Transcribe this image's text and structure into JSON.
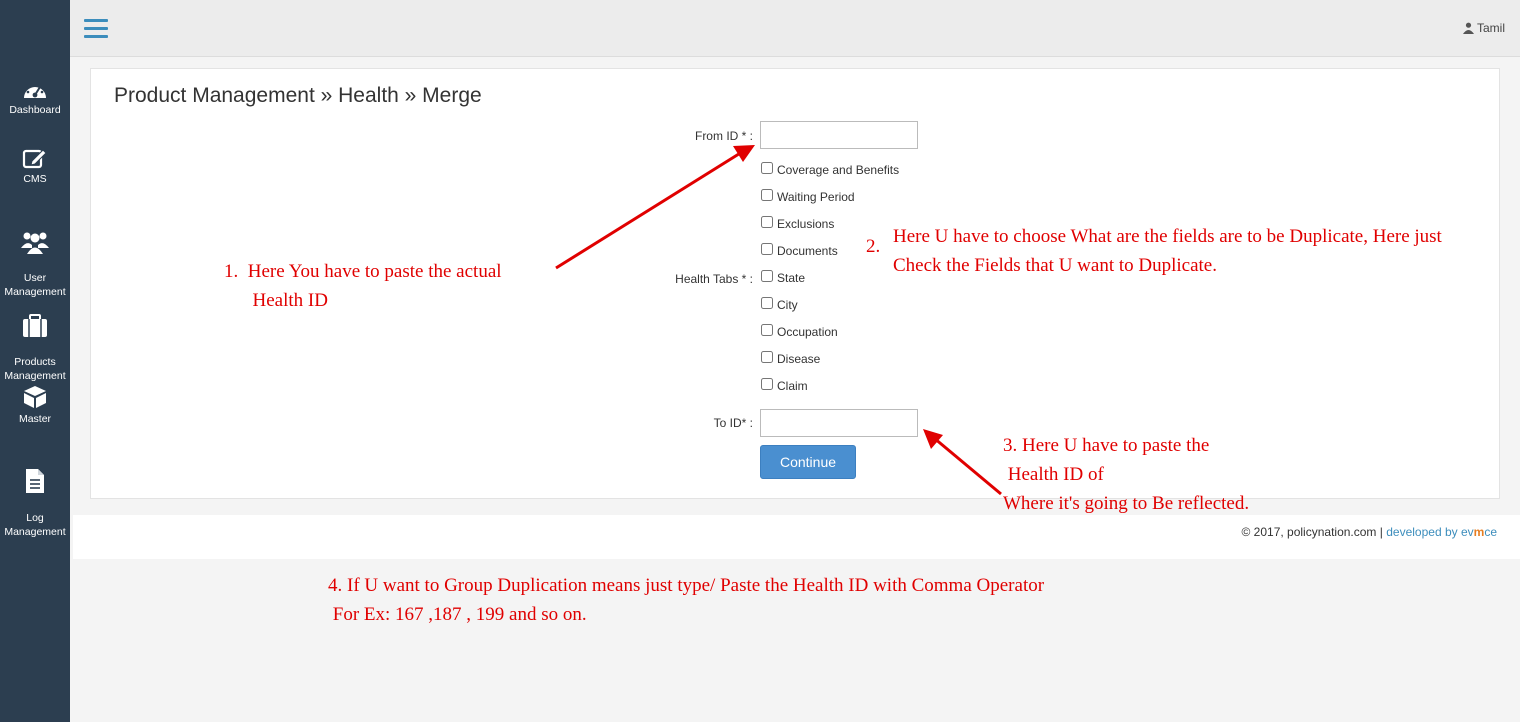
{
  "sidebar": {
    "items": [
      {
        "label": "Dashboard",
        "icon": "dashboard-icon"
      },
      {
        "label": "CMS",
        "icon": "edit-icon"
      },
      {
        "label": "User\nManagement",
        "icon": "users-icon"
      },
      {
        "label": "Products\nManagement",
        "icon": "briefcase-icon"
      },
      {
        "label": "Master",
        "icon": "cube-icon"
      },
      {
        "label": "Log\nManagement",
        "icon": "file-icon"
      }
    ]
  },
  "header": {
    "user_name": "Tamil"
  },
  "main": {
    "breadcrumb": "Product Management » Health » Merge",
    "from_id_label": "From ID * :",
    "from_id_value": "",
    "health_tabs_label": "Health Tabs * :",
    "health_tabs": [
      {
        "label": "Coverage and Benefits",
        "checked": false
      },
      {
        "label": "Waiting Period",
        "checked": false
      },
      {
        "label": "Exclusions",
        "checked": false
      },
      {
        "label": "Documents",
        "checked": false
      },
      {
        "label": "State",
        "checked": false
      },
      {
        "label": "City",
        "checked": false
      },
      {
        "label": "Occupation",
        "checked": false
      },
      {
        "label": "Disease",
        "checked": false
      },
      {
        "label": "Claim",
        "checked": false
      }
    ],
    "to_id_label": "To ID* :",
    "to_id_value": "",
    "continue_label": "Continue"
  },
  "footer": {
    "copyright": "© 2017, policynation.com",
    "separator": "|",
    "developed_by": "developed by ev",
    "brand_mark": "m",
    "brand_tail": "ce"
  },
  "annotations": {
    "note1": "1.  Here You have to paste the actual\n      Health ID",
    "note2_num": "2.",
    "note2": "Here U have to choose What are the fields are to be Duplicate, Here just\nCheck the Fields that U want to Duplicate.",
    "note3": "3. Here U have to paste the\n Health ID of\nWhere it's going to Be reflected.",
    "note4": "4. If U want to Group Duplication means just type/ Paste the Health ID with Comma Operator\n For Ex: 167 ,187 , 199 and so on.",
    "color": "#e00000"
  },
  "colors": {
    "sidebar_bg": "#2c3e50",
    "accent": "#3c8dbc",
    "button_bg": "#4a8fd0"
  }
}
